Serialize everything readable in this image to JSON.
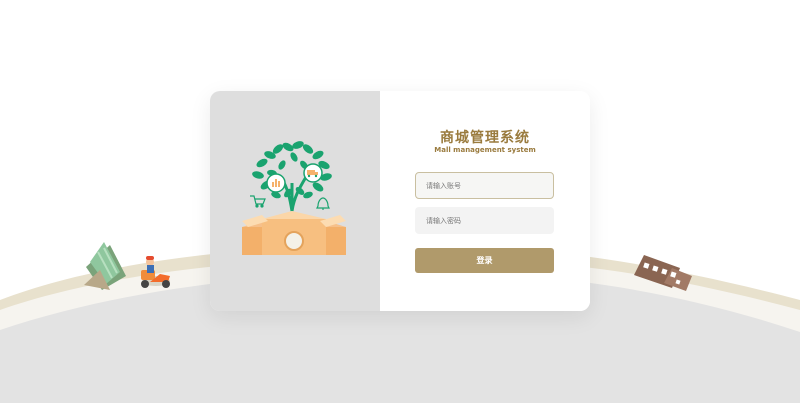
{
  "app": {
    "title": "商城管理系统",
    "subtitle": "Mall management system"
  },
  "form": {
    "account_placeholder": "请输入账号",
    "password_placeholder": "请输入密码",
    "login_label": "登录"
  },
  "colors": {
    "accent": "#b09a6b",
    "title": "#9a7b3e",
    "tree_green": "#1aa36f",
    "illustration_orange": "#f5b26b",
    "card_left_bg": "#dedede",
    "ground": "#e3e3e3"
  }
}
